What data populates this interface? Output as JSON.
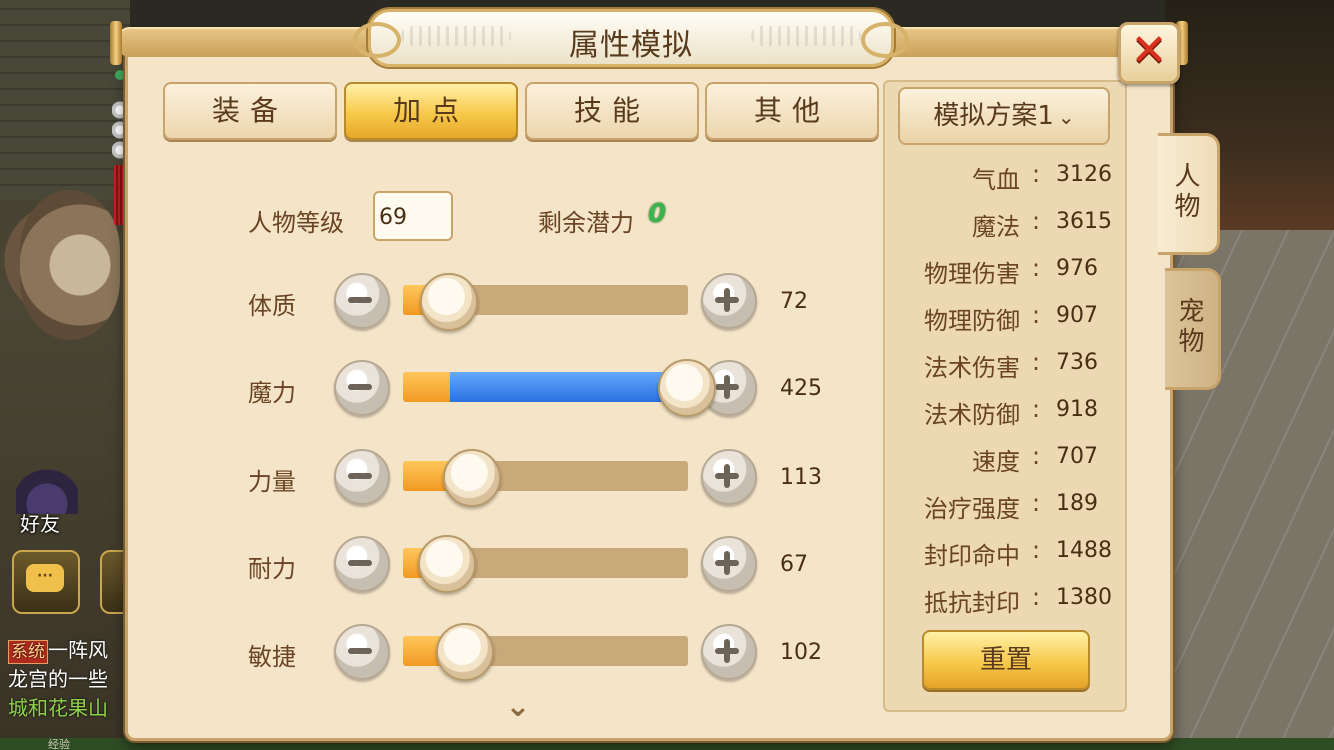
{
  "window": {
    "title": "属性模拟"
  },
  "tabs": [
    {
      "label": "装备",
      "active": false
    },
    {
      "label": "加点",
      "active": true
    },
    {
      "label": "技能",
      "active": false
    },
    {
      "label": "其他",
      "active": false
    }
  ],
  "level": {
    "label": "人物等级",
    "value": "69"
  },
  "potential": {
    "label": "剩余潜力",
    "value": "0"
  },
  "stats": [
    {
      "label": "体质",
      "value": "72",
      "blue_fill": false
    },
    {
      "label": "魔力",
      "value": "425",
      "blue_fill": true
    },
    {
      "label": "力量",
      "value": "113",
      "blue_fill": false
    },
    {
      "label": "耐力",
      "value": "67",
      "blue_fill": false
    },
    {
      "label": "敏捷",
      "value": "102",
      "blue_fill": false
    }
  ],
  "plan": {
    "selected": "模拟方案1"
  },
  "attributes": [
    {
      "name": "气血",
      "value": "3126"
    },
    {
      "name": "魔法",
      "value": "3615"
    },
    {
      "name": "物理伤害",
      "value": "976"
    },
    {
      "name": "物理防御",
      "value": "907"
    },
    {
      "name": "法术伤害",
      "value": "736"
    },
    {
      "name": "法术防御",
      "value": "918"
    },
    {
      "name": "速度",
      "value": "707"
    },
    {
      "name": "治疗强度",
      "value": "189"
    },
    {
      "name": "封印命中",
      "value": "1488"
    },
    {
      "name": "抵抗封印",
      "value": "1380"
    }
  ],
  "reset_label": "重置",
  "side_tabs": [
    {
      "label": "人物",
      "active": true
    },
    {
      "label": "宠物",
      "active": false
    }
  ],
  "hud": {
    "friend_label": "好友",
    "chat_lines": [
      {
        "tag": "系统",
        "text": "一阵风"
      },
      {
        "text": "龙宫的一些"
      },
      {
        "text": "城和花果山"
      }
    ],
    "exp_label": "经验"
  },
  "colors": {
    "panel": "#f5e5c8",
    "accent_gold": "#f7c94a",
    "close_red": "#d8321e",
    "potential_green": "#3bb54a",
    "slider_blue": "#2a6fe0",
    "slider_orange": "#f19a22"
  }
}
